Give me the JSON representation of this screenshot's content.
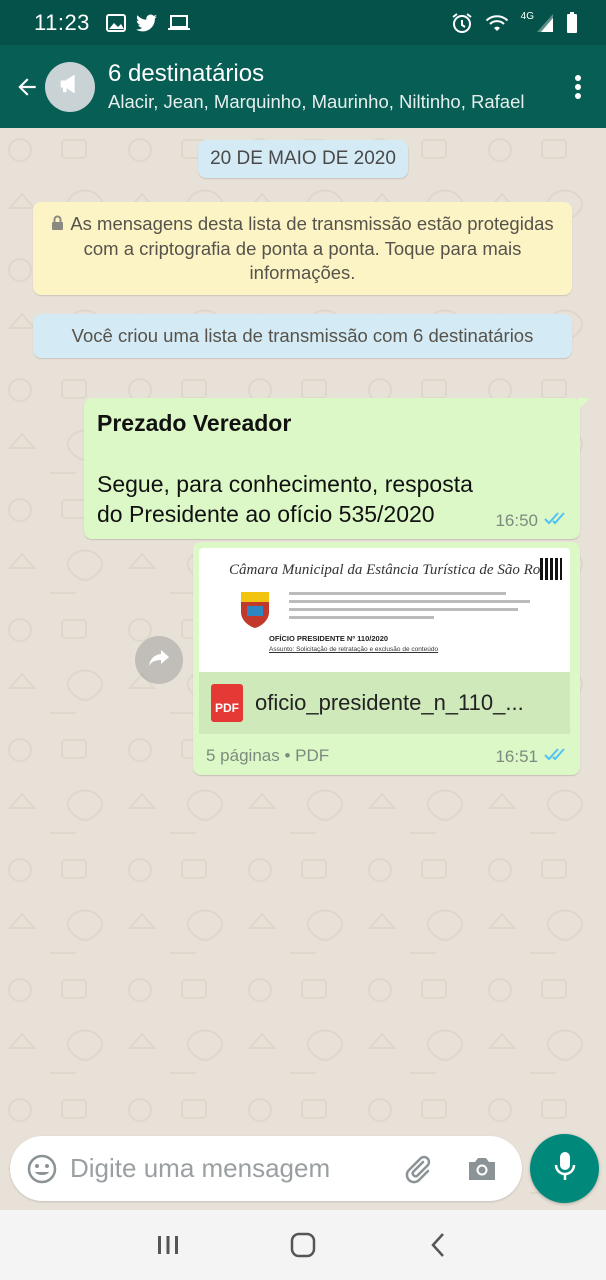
{
  "status_bar": {
    "time": "11:23",
    "network": "4G",
    "left_icons": [
      "gallery-icon",
      "twitter-icon",
      "screen-icon"
    ],
    "right_icons": [
      "alarm-icon",
      "wifi-icon",
      "signal-icon",
      "battery-icon"
    ]
  },
  "header": {
    "title": "6 destinatários",
    "subtitle": "Alacir, Jean, Marquinho, Maurinho, Niltinho, Rafael",
    "back_icon": "arrow-back-icon",
    "avatar_icon": "megaphone-icon",
    "menu_icon": "more-vert-icon"
  },
  "chat": {
    "date_chip": "20 DE MAIO DE 2020",
    "encryption_notice": "As mensagens desta lista de transmissão estão protegidas com a criptografia de ponta a ponta. Toque para mais informações.",
    "broadcast_notice": "Você criou uma lista de transmissão com 6 destinatários",
    "messages": [
      {
        "title": "Prezado Vereador",
        "body": "Segue, para conhecimento, resposta do Presidente ao ofício 535/2020",
        "time": "16:50",
        "status": "delivered"
      },
      {
        "type": "document",
        "preview": {
          "letterhead": "Câmara Municipal da Estância Turística de São Roque",
          "doc_title": "OFÍCIO PRESIDENTE Nº 110/2020",
          "subject": "Assunto: Solicitação de retratação e exclusão de conteúdo"
        },
        "file_icon_label": "PDF",
        "file_name": "oficio_presidente_n_110_...",
        "info": "5 páginas • PDF",
        "time": "16:51",
        "status": "delivered"
      }
    ]
  },
  "composer": {
    "placeholder": "Digite uma mensagem"
  },
  "colors": {
    "header": "#075e54",
    "status_bar": "#04524a",
    "bubble_out": "#dcf8c6",
    "accent": "#00897b",
    "ticks": "#4fc3f7"
  }
}
